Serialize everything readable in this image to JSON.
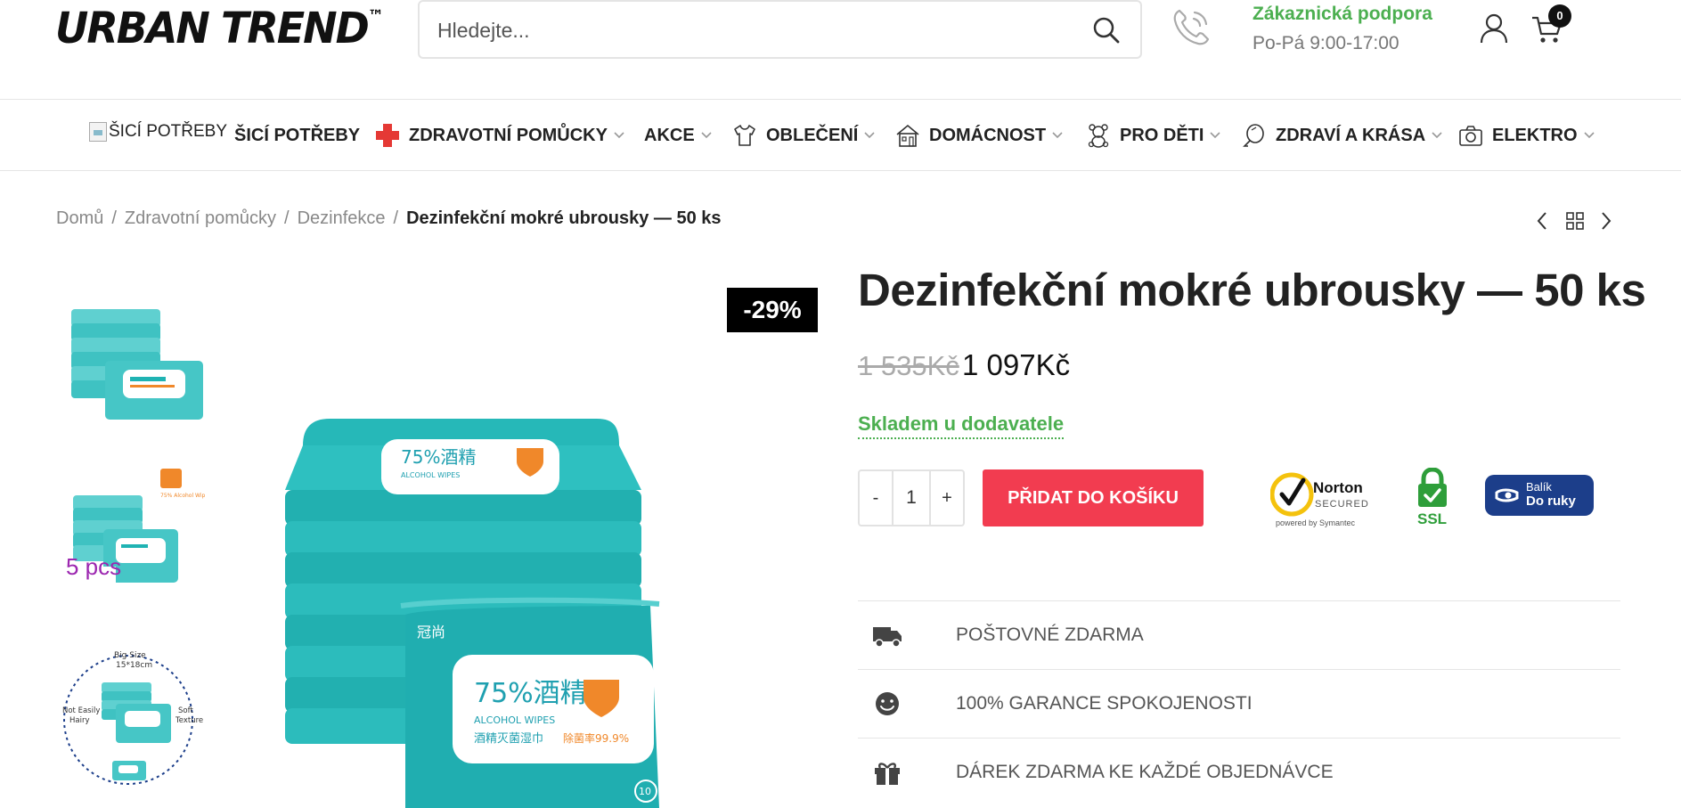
{
  "header": {
    "logo": "URBAN TREND",
    "logo_tm": "™",
    "search_placeholder": "Hledejte...",
    "support_title": "Zákaznická podpora",
    "support_hours": "Po-Pá 9:00-17:00",
    "cart_count": "0"
  },
  "nav": {
    "broken_img_alt": "ŠICÍ POTŘEBY",
    "items": [
      {
        "label": "ŠICÍ POTŘEBY",
        "icon": "broken-image-icon"
      },
      {
        "label": "ZDRAVOTNÍ POMŮCKY",
        "icon": "red-cross-icon"
      },
      {
        "label": "AKCE",
        "icon": ""
      },
      {
        "label": "OBLEČENÍ",
        "icon": "tshirt-icon"
      },
      {
        "label": "DOMÁCNOST",
        "icon": "house-icon"
      },
      {
        "label": "PRO DĚTI",
        "icon": "teddy-bear-icon"
      },
      {
        "label": "ZDRAVÍ A KRÁSA",
        "icon": "mirror-icon"
      },
      {
        "label": "ELEKTRO",
        "icon": "camera-icon"
      }
    ]
  },
  "breadcrumb": {
    "items": [
      "Domů",
      "Zdravotní pomůcky",
      "Dezinfekce"
    ],
    "current": "Dezinfekční mokré ubrousky — 50 ks",
    "separator": "/"
  },
  "product": {
    "title": "Dezinfekční mokré ubrousky — 50 ks",
    "old_price": "1 535Kč",
    "price": "1 097Kč",
    "discount": "-29%",
    "stock": "Skladem u dodavatele",
    "quantity": "1",
    "qty_minus": "-",
    "qty_plus": "+",
    "add_to_cart": "PŘIDAT DO KOŠÍKU"
  },
  "gallery": {
    "thumb2_caption": "5 pcs",
    "thumb3_top": "Big Size",
    "thumb3_size": "15*18cm",
    "thumb3_left": "Not Easily Hairy",
    "thumb3_right": "Soft Texture",
    "pack_text": "75%酒精",
    "pack_sub": "ALCOHOL WIPES",
    "pack_cn": "酒精灭菌湿巾",
    "pack_rate": "除菌率99.9%",
    "pack_count": "10"
  },
  "badges": {
    "norton_line1": "Norton",
    "norton_line2": "SECURED",
    "norton_line3": "powered by Symantec",
    "ssl": "SSL",
    "balik_line1": "Balík",
    "balik_line2": "Do ruky"
  },
  "benefits": [
    {
      "label": "POŠTOVNÉ ZDARMA",
      "icon": "truck-icon"
    },
    {
      "label": "100% GARANCE SPOKOJENOSTI",
      "icon": "smiley-icon"
    },
    {
      "label": "DÁREK ZDARMA KE KAŽDÉ OBJEDNÁVCE",
      "icon": "gift-icon"
    }
  ],
  "colors": {
    "accent": "#f23c50",
    "stock_green": "#4caf50",
    "teal": "#1fb3b3"
  }
}
